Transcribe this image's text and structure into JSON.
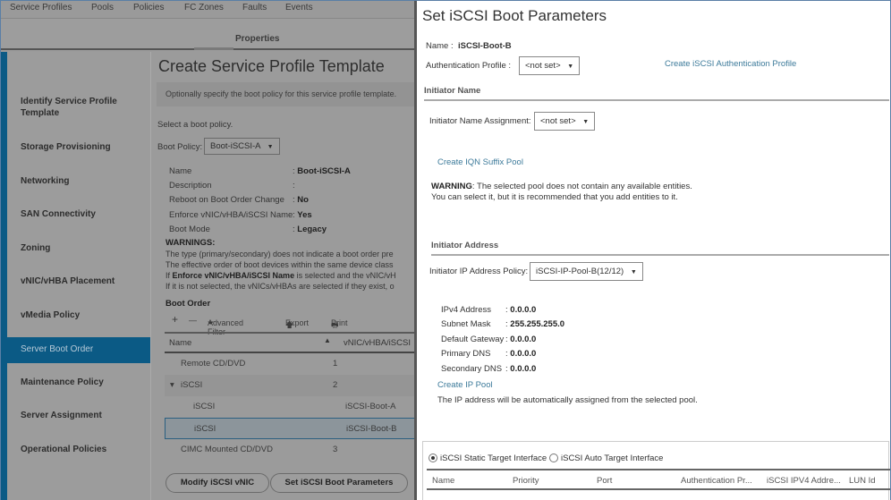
{
  "topnav": {
    "tabs": [
      "Service Profiles",
      "Pools",
      "Policies",
      "FC Zones",
      "Faults",
      "Events"
    ]
  },
  "properties_tab": "Properties",
  "sidebar": {
    "items": [
      {
        "label": "Identify Service Profile Template"
      },
      {
        "label": "Storage Provisioning"
      },
      {
        "label": "Networking"
      },
      {
        "label": "SAN Connectivity"
      },
      {
        "label": "Zoning"
      },
      {
        "label": "vNIC/vHBA Placement"
      },
      {
        "label": "vMedia Policy"
      },
      {
        "label": "Server Boot Order"
      },
      {
        "label": "Maintenance Policy"
      },
      {
        "label": "Server Assignment"
      },
      {
        "label": "Operational Policies"
      }
    ],
    "active": "Server Boot Order",
    "accent_color": "#0b5a85"
  },
  "main": {
    "title": "Create Service Profile Template",
    "hint": "Optionally specify the boot policy for this service profile template.",
    "select_label": "Select a boot policy.",
    "boot_policy_label": "Boot Policy:",
    "boot_policy_value": "Boot-iSCSI-A",
    "details": [
      {
        "label": "Name",
        "value": "Boot-iSCSI-A"
      },
      {
        "label": "Description",
        "value": ""
      },
      {
        "label": "Reboot on Boot Order Change",
        "value": "No"
      },
      {
        "label": "Enforce vNIC/vHBA/iSCSI Name",
        "value": "Yes"
      },
      {
        "label": "Boot Mode",
        "value": "Legacy"
      }
    ],
    "warnings_title": "WARNINGS:",
    "warnings": [
      "The type (primary/secondary) does not indicate a boot order pre",
      "The effective order of boot devices within the same device class",
      "is selected and the vNIC/vH",
      "If it is not selected, the vNICs/vHBAs are selected if they exist, o"
    ],
    "warning_bold": "Enforce vNIC/vHBA/iSCSI Name",
    "warning_if": "If",
    "boot_order_title": "Boot Order",
    "toolbar": {
      "add": "+",
      "remove": "—",
      "filter": "Advanced Filter",
      "export": "Export",
      "print": "Print"
    },
    "columns": [
      "Name",
      "vNIC/vHBA/iSCSI"
    ],
    "rows": [
      {
        "name": "Remote CD/DVD",
        "order": "1",
        "vnic": ""
      },
      {
        "name": "iSCSI",
        "order": "2",
        "vnic": ""
      },
      {
        "name": "iSCSI",
        "order": "",
        "vnic": "iSCSI-Boot-A"
      },
      {
        "name": "iSCSI",
        "order": "",
        "vnic": "iSCSI-Boot-B"
      },
      {
        "name": "CIMC Mounted CD/DVD",
        "order": "3",
        "vnic": ""
      }
    ],
    "buttons": {
      "modify": "Modify iSCSI vNIC",
      "set": "Set iSCSI Boot Parameters"
    }
  },
  "dialog": {
    "title": "Set iSCSI Boot Parameters",
    "name_label": "Name :",
    "name_value": "iSCSI-Boot-B",
    "auth_label": "Authentication Profile :",
    "auth_value": "<not set>",
    "auth_link": "Create iSCSI Authentication Profile",
    "initiator_name_section": "Initiator Name",
    "init_assign_label": "Initiator Name Assignment:",
    "init_assign_value": "<not set>",
    "iqn_link": "Create IQN Suffix Pool",
    "warning_bold": "WARNING",
    "warning_line1": ": The selected pool does not contain any available entities.",
    "warning_line2": "You can select it, but it is recommended that you add entities to it.",
    "initiator_address_section": "Initiator Address",
    "ip_policy_label": "Initiator IP Address Policy:",
    "ip_policy_value": "iSCSI-IP-Pool-B(12/12)",
    "addresses": [
      {
        "label": "IPv4 Address",
        "value": "0.0.0.0"
      },
      {
        "label": "Subnet Mask",
        "value": "255.255.255.0"
      },
      {
        "label": "Default Gateway",
        "value": "0.0.0.0"
      },
      {
        "label": "Primary DNS",
        "value": "0.0.0.0"
      },
      {
        "label": "Secondary DNS",
        "value": "0.0.0.0"
      }
    ],
    "ip_pool_link": "Create IP Pool",
    "ip_note": "The IP address will be automatically assigned from the selected pool.",
    "target": {
      "static_label": "iSCSI Static Target Interface",
      "auto_label": "iSCSI Auto Target Interface",
      "selected": "static",
      "columns": [
        "Name",
        "Priority",
        "Port",
        "Authentication Pr...",
        "iSCSI IPV4 Addre...",
        "LUN Id"
      ]
    }
  }
}
